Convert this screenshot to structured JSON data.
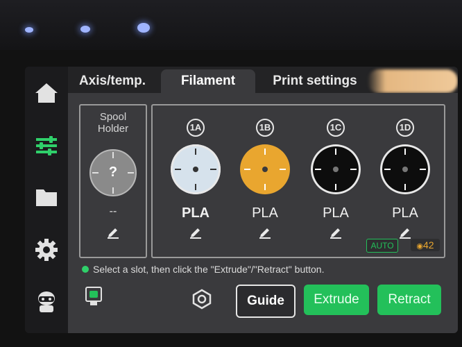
{
  "sidebar": {
    "items": [
      {
        "icon": "home-icon"
      },
      {
        "icon": "sliders-icon",
        "active": true
      },
      {
        "icon": "folder-icon"
      },
      {
        "icon": "gear-icon"
      },
      {
        "icon": "robot-icon"
      }
    ]
  },
  "tabs": [
    {
      "label": "Axis/temp."
    },
    {
      "label": "Filament",
      "active": true
    },
    {
      "label": "Print settings"
    }
  ],
  "spool_holder": {
    "title_line1": "Spool",
    "title_line2": "Holder",
    "spool_mark": "?",
    "material": "--"
  },
  "slots": [
    {
      "id": "1A",
      "color": "#d6e2ec",
      "material": "PLA",
      "bold": true
    },
    {
      "id": "1B",
      "color": "#e9a62f",
      "material": "PLA",
      "bold": false
    },
    {
      "id": "1C",
      "color": "#0d0d0d",
      "material": "PLA",
      "bold": false
    },
    {
      "id": "1D",
      "color": "#0d0d0d",
      "material": "PLA",
      "bold": false
    }
  ],
  "status": {
    "auto_label": "AUTO",
    "humidity_value": "42"
  },
  "hint": {
    "text": "Select a slot, then click the \"Extrude\"/\"Retract\" button."
  },
  "buttons": {
    "guide": "Guide",
    "extrude": "Extrude",
    "retract": "Retract"
  },
  "colors": {
    "accent_green": "#23c05a",
    "humidity_orange": "#e9a62f"
  }
}
